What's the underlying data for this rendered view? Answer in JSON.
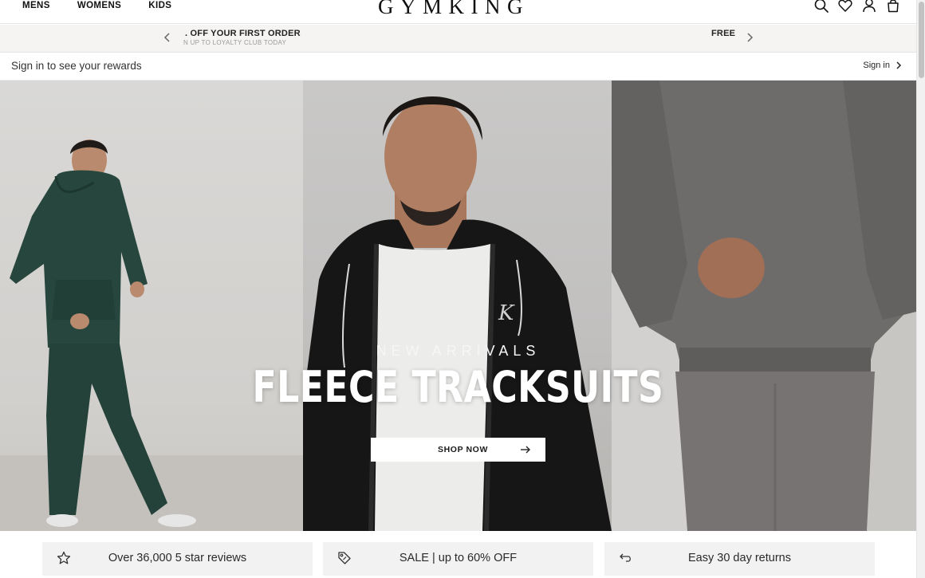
{
  "nav": {
    "links": [
      "MENS",
      "WOMENS",
      "KIDS"
    ],
    "logo": "GYMKING",
    "icons": [
      "search-icon",
      "heart-icon",
      "account-icon",
      "bag-icon"
    ]
  },
  "promo": {
    "main": ". OFF YOUR FIRST ORDER",
    "sub": "N UP TO LOYALTY CLUB TODAY",
    "right": "FREE"
  },
  "rewards": {
    "text": "Sign in to see your rewards",
    "signin": "Sign in"
  },
  "hero": {
    "eyebrow": "NEW ARRIVALS",
    "title": "FLEECE TRACKSUITS",
    "button": "SHOP NOW"
  },
  "usps": [
    {
      "text": "Over 36,000 5 star reviews",
      "icon": "star-icon"
    },
    {
      "text": "SALE | up to 60% OFF",
      "icon": "tag-icon"
    },
    {
      "text": "Easy 30 day returns",
      "icon": "return-icon"
    }
  ],
  "colors": {
    "background": "#ffffff",
    "promo_bg": "#f5f4f2",
    "usp_bg": "#f2f2f2",
    "text": "#1a1a1a",
    "hero_text": "#ffffff"
  }
}
